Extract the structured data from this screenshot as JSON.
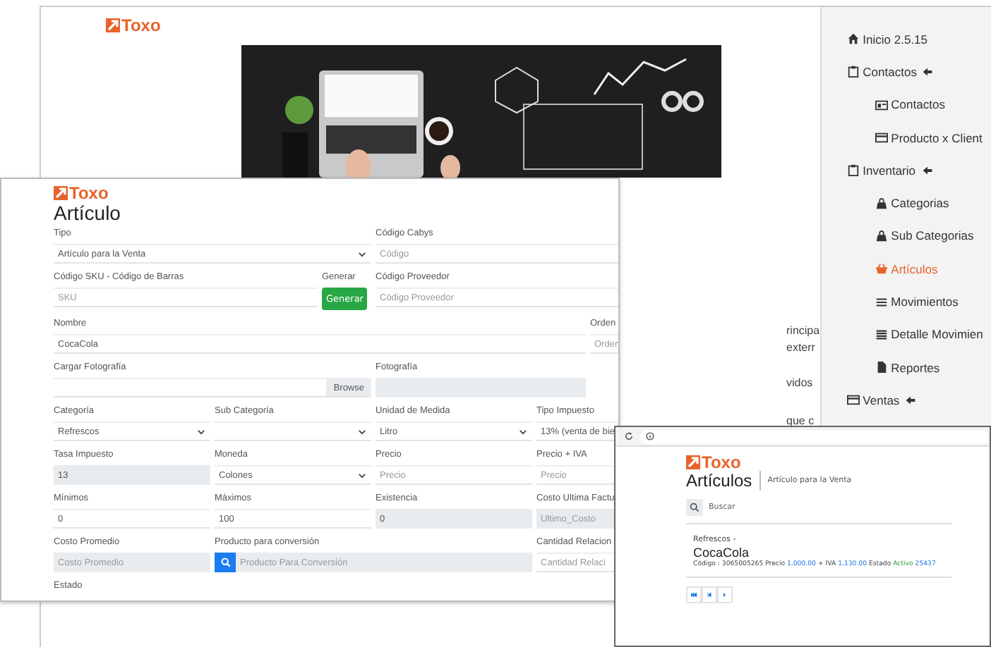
{
  "background_window": {
    "logo": "Toxo",
    "text_fragments": [
      "rincipa",
      "exterr",
      "vidos",
      "que c"
    ],
    "sidebar": {
      "items": [
        {
          "label": "Inicio 2.5.15",
          "selected": false
        },
        {
          "label": "Contactos",
          "selected": false,
          "children": [
            {
              "label": "Contactos",
              "selected": false
            },
            {
              "label": "Producto x Client",
              "selected": false
            }
          ]
        },
        {
          "label": "Inventario",
          "selected": false,
          "children": [
            {
              "label": "Categorias",
              "selected": false
            },
            {
              "label": "Sub Categorias",
              "selected": false
            },
            {
              "label": "Artículos",
              "selected": true
            },
            {
              "label": "Movimientos",
              "selected": false
            },
            {
              "label": "Detalle Movimien",
              "selected": false
            },
            {
              "label": "Reportes",
              "selected": false
            }
          ]
        },
        {
          "label": "Ventas",
          "selected": false
        }
      ]
    }
  },
  "form_window": {
    "logo": "Toxo",
    "title": "Artículo",
    "fields": [
      {
        "label": "Tipo",
        "kind": "select",
        "value": "Artículo para la Venta"
      },
      {
        "label": "Código Cabys",
        "kind": "input",
        "placeholder": "Código"
      },
      {
        "label": "Código SKU - Código de Barras",
        "kind": "input",
        "placeholder": "SKU"
      },
      {
        "label": "Generar",
        "kind": "button",
        "button": "Generar"
      },
      {
        "label": "Código Proveedor",
        "kind": "input",
        "placeholder": "Código Proveedor"
      },
      {
        "label": "Nombre",
        "kind": "input",
        "value": "CocaCola"
      },
      {
        "label": "Orden",
        "kind": "input",
        "placeholder": "Orden"
      },
      {
        "label": "Cargar Fotografía",
        "kind": "file",
        "button": "Browse"
      },
      {
        "label": "Fotografía",
        "kind": "readonly"
      },
      {
        "label": "Categoría",
        "kind": "select",
        "value": "Refrescos"
      },
      {
        "label": "Sub Categoría",
        "kind": "select"
      },
      {
        "label": "Unidad de Medida",
        "kind": "select",
        "value": "Litro"
      },
      {
        "label": "Tipo Impuesto",
        "kind": "select",
        "value": "13% (venta de bie"
      },
      {
        "label": "Tasa Impuesto",
        "kind": "readonly",
        "value": "13"
      },
      {
        "label": "Moneda",
        "kind": "select",
        "value": "Colones"
      },
      {
        "label": "Precio",
        "kind": "input",
        "placeholder": "Precio"
      },
      {
        "label": "Precio + IVA",
        "kind": "input",
        "placeholder": "Precio"
      },
      {
        "label": "Mínimos",
        "kind": "input",
        "value": "0"
      },
      {
        "label": "Máximos",
        "kind": "input",
        "value": "100"
      },
      {
        "label": "Existencia",
        "kind": "readonly",
        "value": "0"
      },
      {
        "label": "Costo Ultima Factu",
        "kind": "readonly",
        "placeholder": "Ultimo_Costo"
      },
      {
        "label": "Costo Promedio",
        "kind": "readonly",
        "placeholder": "Costo Promedio"
      },
      {
        "label": "Producto para conversión",
        "kind": "search",
        "placeholder": "Producto Para Conversión"
      },
      {
        "label": "Cantidad Relacion",
        "kind": "input",
        "placeholder": "Cantidad Relaci"
      },
      {
        "label": "Estado",
        "kind": "label"
      }
    ]
  },
  "list_window": {
    "logo": "Toxo",
    "title": "Artículos",
    "subtitle": "Artículo para la Venta",
    "search": {
      "placeholder": "Buscar"
    },
    "item": {
      "category": "Refrescos -",
      "name": "CocaCola",
      "details": [
        {
          "kind": "text",
          "text": "Código : 3065005265"
        },
        {
          "kind": "text",
          "text": "Precio"
        },
        {
          "kind": "money",
          "text": "1,000.00"
        },
        {
          "kind": "text",
          "text": "+ IVA"
        },
        {
          "kind": "money",
          "text": "1,130.00"
        },
        {
          "kind": "text",
          "text": "Estado"
        },
        {
          "kind": "status",
          "text": "Activo"
        },
        {
          "kind": "money",
          "text": "25437"
        }
      ]
    }
  }
}
